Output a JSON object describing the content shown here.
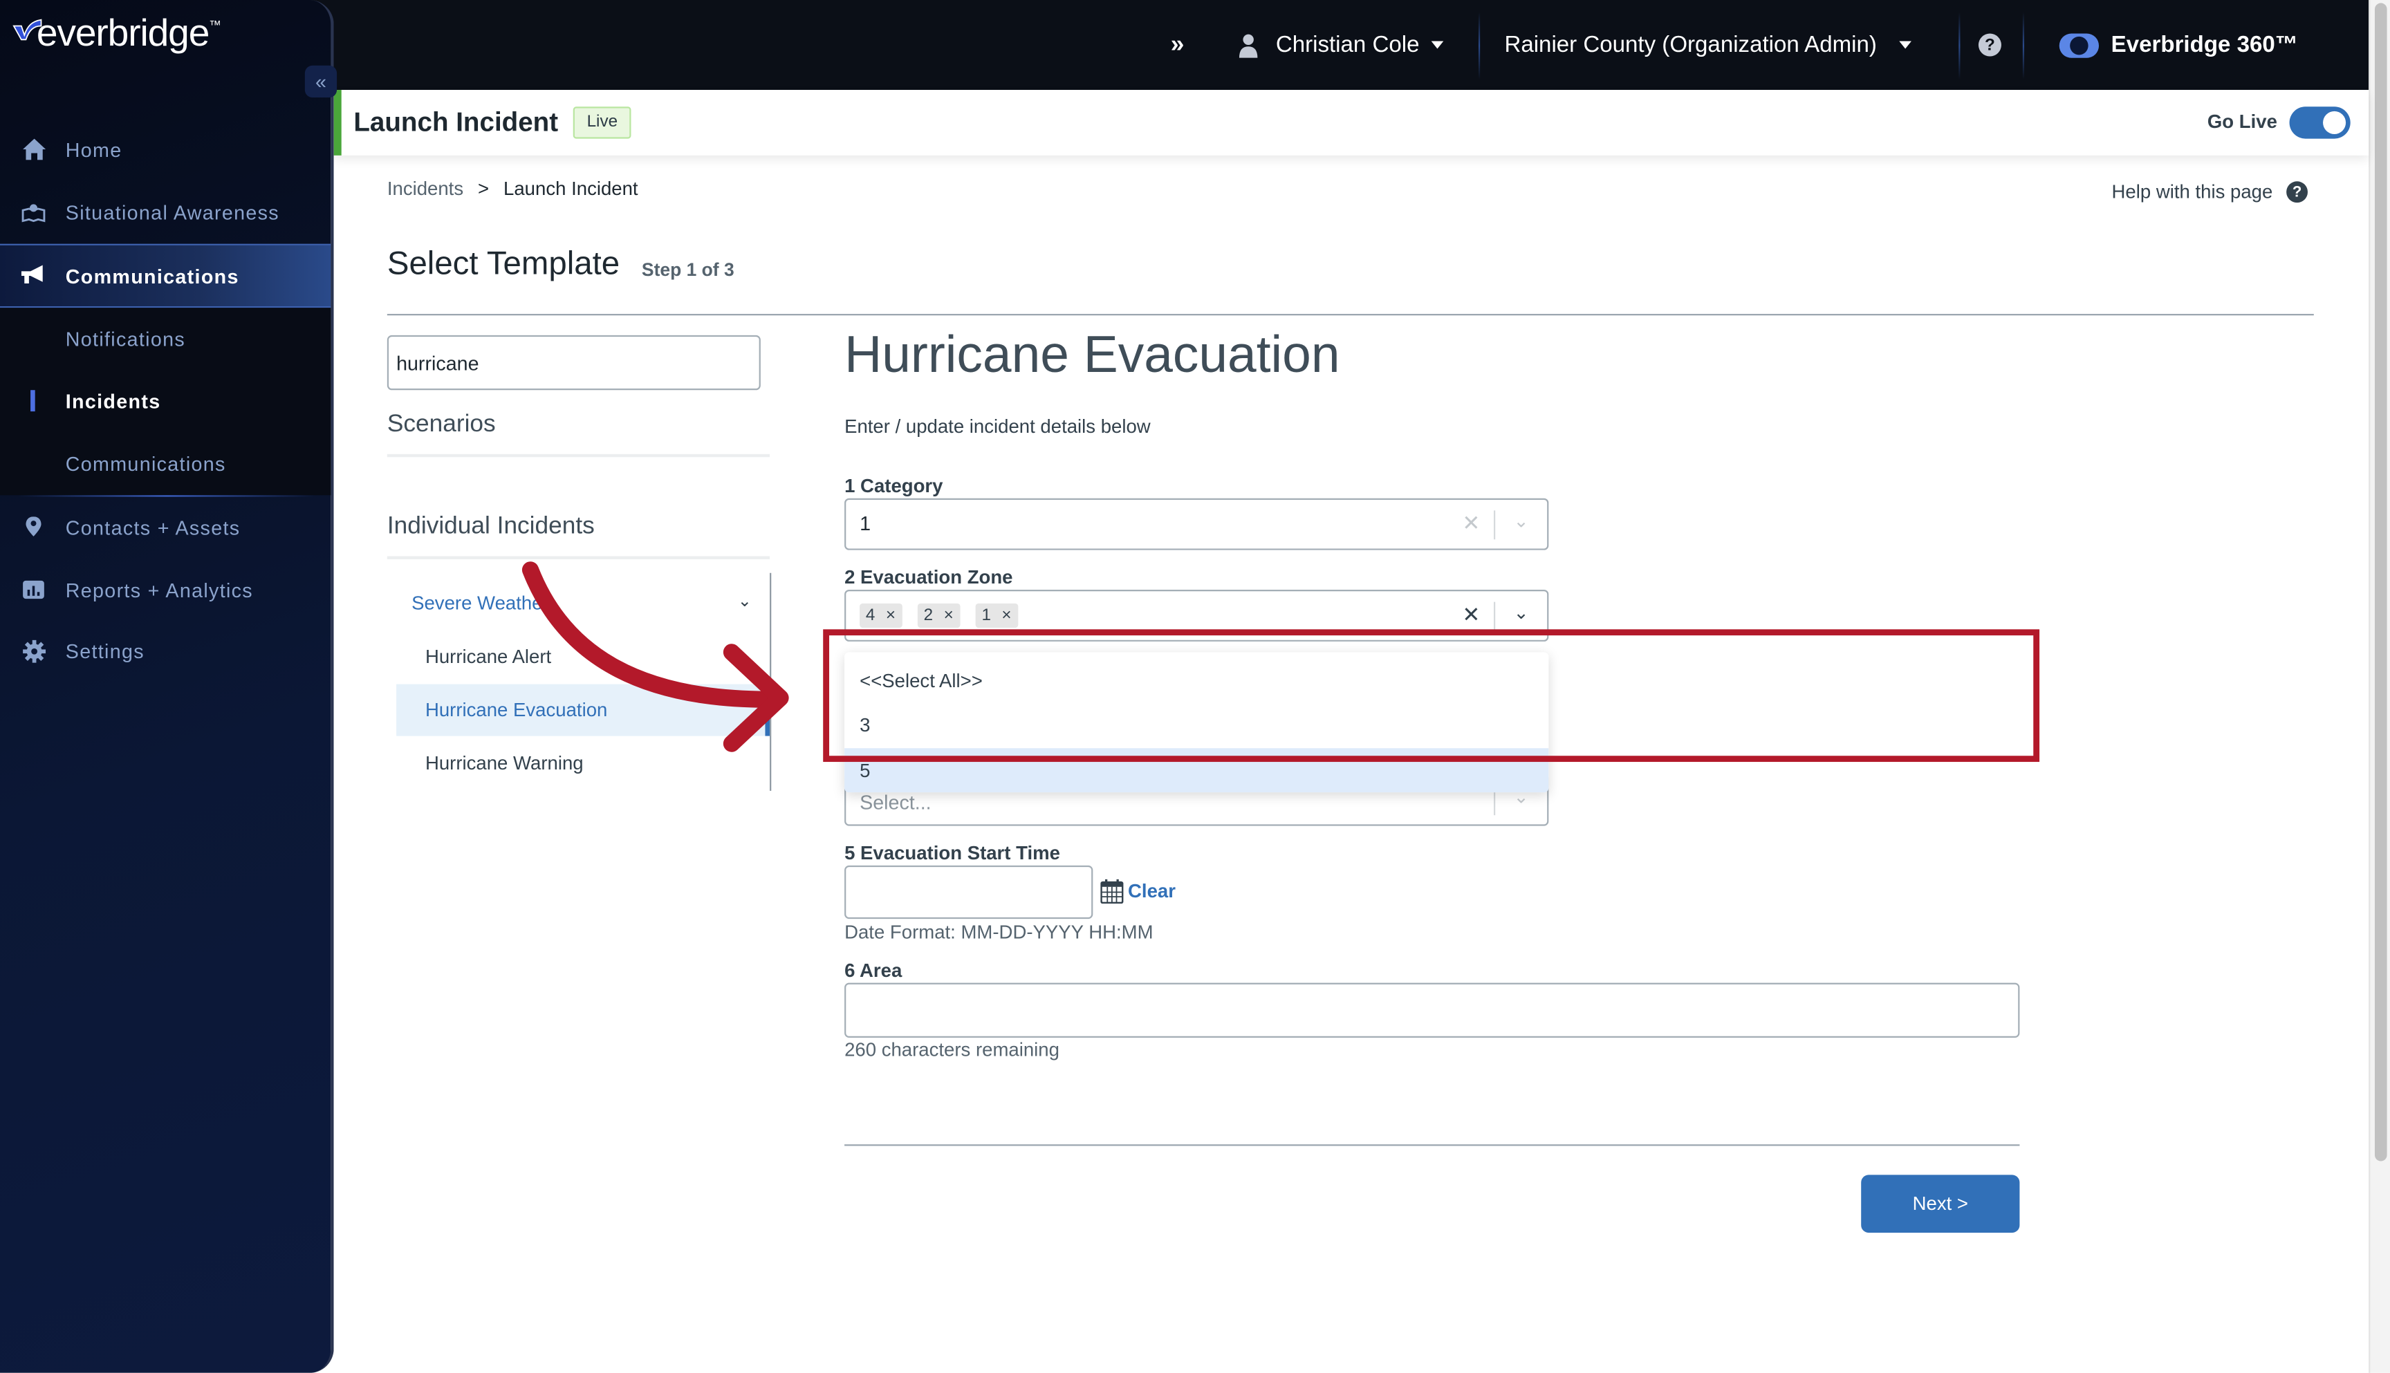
{
  "app": {
    "brand": "everbridge",
    "brand_tm": "™"
  },
  "topbar": {
    "expand_icon": "double-chevron-right",
    "user_name": "Christian Cole",
    "organization": "Rainier County (Organization Admin)",
    "help_icon": "question-circle",
    "product_toggle_label": "Everbridge 360™"
  },
  "sidebar": {
    "collapse_icon": "«",
    "items": [
      {
        "label": "Home",
        "icon": "home-icon"
      },
      {
        "label": "Situational Awareness",
        "icon": "map-icon"
      },
      {
        "label": "Communications",
        "icon": "megaphone-icon",
        "active": true
      },
      {
        "label": "Contacts + Assets",
        "icon": "location-pin-icon"
      },
      {
        "label": "Reports + Analytics",
        "icon": "bar-chart-icon"
      },
      {
        "label": "Settings",
        "icon": "gear-icon"
      }
    ],
    "sub_items": [
      {
        "label": "Notifications"
      },
      {
        "label": "Incidents",
        "current": true
      },
      {
        "label": "Communications"
      }
    ]
  },
  "page_header": {
    "title": "Launch Incident",
    "badge": "Live",
    "go_live_label": "Go Live",
    "go_live_on": true
  },
  "breadcrumb": {
    "parent": "Incidents",
    "separator": ">",
    "current": "Launch Incident"
  },
  "help_link": "Help with this page",
  "step": {
    "title": "Select Template",
    "subtitle": "Step 1 of 3"
  },
  "template_panel": {
    "search_value": "hurricane",
    "scenarios_heading": "Scenarios",
    "individual_heading": "Individual Incidents",
    "group_label": "Severe Weather",
    "items": [
      {
        "label": "Hurricane Alert"
      },
      {
        "label": "Hurricane Evacuation",
        "selected": true
      },
      {
        "label": "Hurricane Warning"
      }
    ]
  },
  "form": {
    "title": "Hurricane Evacuation",
    "intro": "Enter / update incident details below",
    "fields": {
      "category": {
        "label": "1 Category",
        "value": "1"
      },
      "evacuation_zone": {
        "label": "2 Evacuation Zone",
        "chips": [
          "4",
          "2",
          "1"
        ],
        "chip_remove": "×",
        "options": [
          "<<Select All>>",
          "3",
          "5"
        ],
        "highlighted_option": "5"
      },
      "hidden_select": {
        "placeholder": "Select..."
      },
      "start_time": {
        "label": "5 Evacuation Start Time",
        "value": "",
        "clear_label": "Clear",
        "date_format": "Date Format: MM-DD-YYYY HH:MM"
      },
      "area": {
        "label": "6 Area",
        "value": "",
        "remaining": "260 characters remaining"
      }
    },
    "next_label": "Next >"
  },
  "colors": {
    "accent": "#3170b8",
    "live_green": "#4aa63a",
    "annotation_red": "#b3192a",
    "sidebar_bg": "#0b1735"
  }
}
